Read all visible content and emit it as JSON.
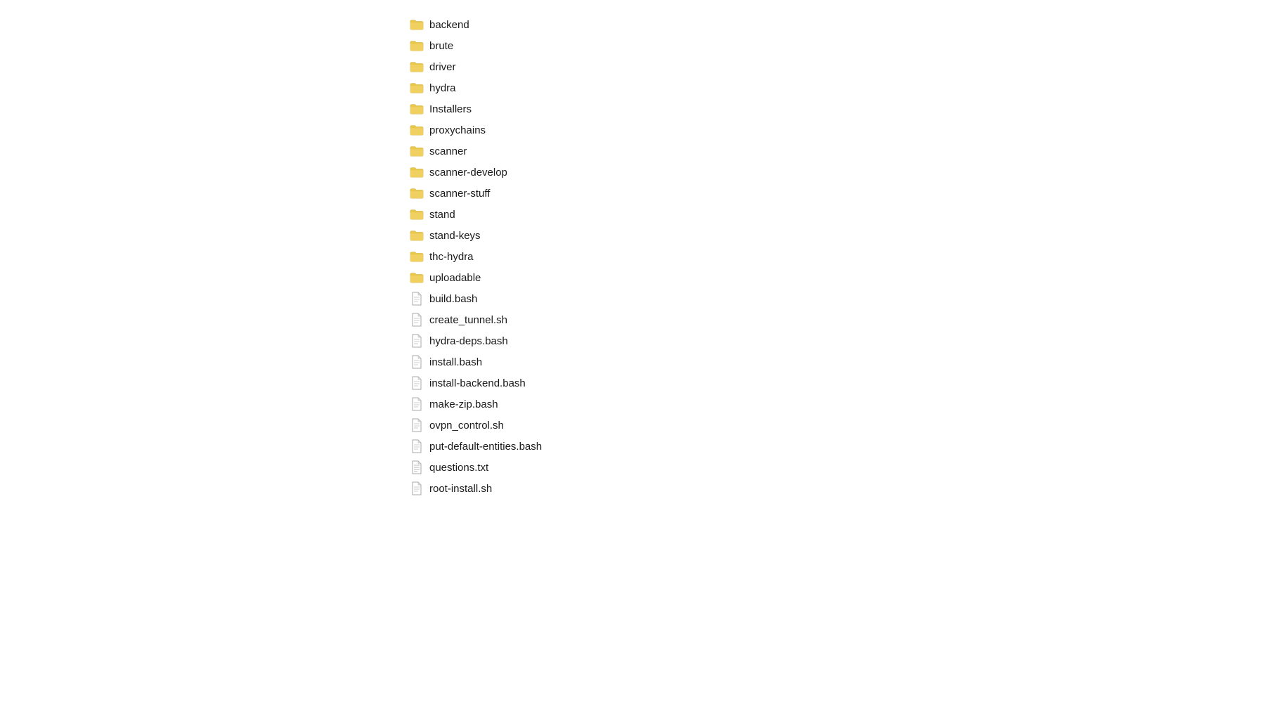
{
  "items": [
    {
      "name": "backend",
      "type": "folder"
    },
    {
      "name": "brute",
      "type": "folder"
    },
    {
      "name": "driver",
      "type": "folder"
    },
    {
      "name": "hydra",
      "type": "folder"
    },
    {
      "name": "Installers",
      "type": "folder"
    },
    {
      "name": "proxychains",
      "type": "folder"
    },
    {
      "name": "scanner",
      "type": "folder"
    },
    {
      "name": "scanner-develop",
      "type": "folder"
    },
    {
      "name": "scanner-stuff",
      "type": "folder"
    },
    {
      "name": "stand",
      "type": "folder"
    },
    {
      "name": "stand-keys",
      "type": "folder"
    },
    {
      "name": "thc-hydra",
      "type": "folder"
    },
    {
      "name": "uploadable",
      "type": "folder"
    },
    {
      "name": "build.bash",
      "type": "file"
    },
    {
      "name": "create_tunnel.sh",
      "type": "file"
    },
    {
      "name": "hydra-deps.bash",
      "type": "file"
    },
    {
      "name": "install.bash",
      "type": "file"
    },
    {
      "name": "install-backend.bash",
      "type": "file"
    },
    {
      "name": "make-zip.bash",
      "type": "file"
    },
    {
      "name": "ovpn_control.sh",
      "type": "file"
    },
    {
      "name": "put-default-entities.bash",
      "type": "file"
    },
    {
      "name": "questions.txt",
      "type": "file-text"
    },
    {
      "name": "root-install.sh",
      "type": "file"
    }
  ],
  "colors": {
    "folder": "#E8C84A",
    "folder_dark": "#C9A830",
    "file": "#9E9E9E",
    "file_lines": "#cccccc"
  }
}
